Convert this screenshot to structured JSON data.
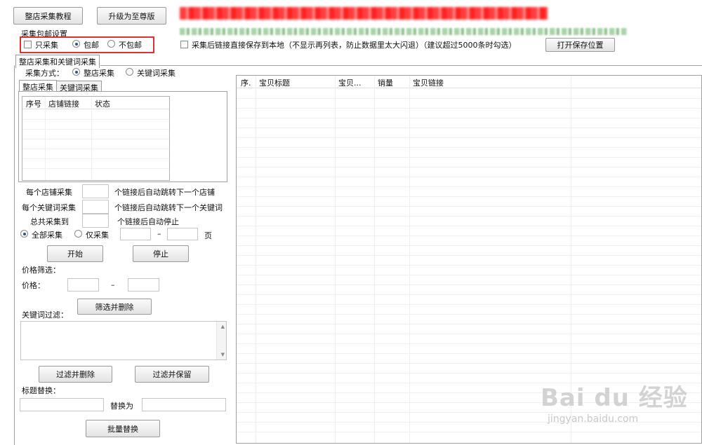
{
  "top_buttons": {
    "tutorial": "整店采集教程",
    "upgrade": "升级为至尊版"
  },
  "shipping_group": {
    "title": "采集包邮设置",
    "only_collect": "只采集",
    "free_shipping": "包邮",
    "no_free_shipping": "不包邮"
  },
  "save_option": {
    "label": "采集后链接直接保存到本地（不显示再列表，防止数据里太大闪退）（建议超过5000条时勾选）",
    "open_button": "打开保存位置"
  },
  "main_tab": "整店采集和关键词采集",
  "collect_mode": {
    "label": "采集方式：",
    "store": "整店采集",
    "keyword": "关键词采集"
  },
  "inner_tabs": {
    "store": "整店采集",
    "keyword": "关键词采集"
  },
  "store_table": {
    "headers": [
      "序号",
      "店铺链接",
      "状态"
    ]
  },
  "per_store": {
    "label": "每个店铺采集",
    "suffix": "个链接后自动跳转下一个店铺"
  },
  "per_keyword": {
    "label": "每个关键词采集",
    "suffix": "个链接后自动跳转下一个关键词"
  },
  "total": {
    "label": "总共采集到",
    "suffix": "个链接后自动停止"
  },
  "pages": {
    "all": "全部采集",
    "only": "仅采集",
    "dash": "–",
    "unit": "页"
  },
  "start_button": "开始",
  "stop_button": "停止",
  "price_filter": {
    "title": "价格筛选：",
    "label": "价格：",
    "dash": "–"
  },
  "keyword_filter": {
    "label": "关键词过滤：",
    "filter_delete": "筛选并删除"
  },
  "filter_buttons": {
    "delete": "过滤并删除",
    "keep": "过滤并保留"
  },
  "title_replace": {
    "label": "标题替换：",
    "replace_with": "替换为",
    "batch": "批量替换"
  },
  "results_table": {
    "headers": [
      "序.",
      "宝贝标题",
      "宝贝...",
      "销量",
      "宝贝链接"
    ]
  },
  "watermark": {
    "brand": "Bai du 经验",
    "url": "jingyan.baidu.com"
  },
  "colors": {
    "highlight_border": "#e03030",
    "radio_dot": "#2b4f9e"
  }
}
